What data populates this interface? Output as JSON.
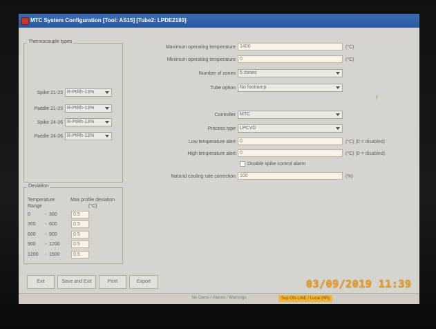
{
  "window": {
    "title": "MTC System Configuration [Tool: AS15] [Tube2: LPDE2180]"
  },
  "thermocouple": {
    "legend": "Thermocouple types",
    "rows": [
      {
        "label": "Spike 21-23",
        "value": "R-PtRh-13%"
      },
      {
        "label": "Paddle 21-23",
        "value": "R-PtRh-13%"
      },
      {
        "label": "Spike 24-26",
        "value": "R-PtRh-13%"
      },
      {
        "label": "Paddle 24-26",
        "value": "R-PtRh-13%"
      }
    ]
  },
  "deviation": {
    "legend": "Deviation",
    "col1": "Temperature\nRange",
    "col2": "Max profile deviation\n(°C)",
    "rows": [
      {
        "from": "0",
        "to": "300",
        "value": "0.5"
      },
      {
        "from": "300",
        "to": "600",
        "value": "0.5"
      },
      {
        "from": "600",
        "to": "900",
        "value": "0.5"
      },
      {
        "from": "900",
        "to": "1200",
        "value": "0.5"
      },
      {
        "from": "1200",
        "to": "1500",
        "value": "0.5"
      }
    ]
  },
  "settings": {
    "max_temp": {
      "label": "Maximum operating temperature",
      "value": "1400",
      "unit": "(°C)"
    },
    "min_temp": {
      "label": "Minimum operating temperature",
      "value": "0",
      "unit": "(°C)"
    },
    "zones": {
      "label": "Number of zones",
      "value": "5 zones"
    },
    "tube_option": {
      "label": "Tube option",
      "value": "No footramp"
    },
    "controller": {
      "label": "Controller",
      "value": "MTC"
    },
    "process_type": {
      "label": "Process type",
      "value": "LPCVD"
    },
    "low_alert": {
      "label": "Low temperature alert",
      "value": "0",
      "unit": "(°C)  (0 = disabled)"
    },
    "high_alert": {
      "label": "High temperature alert",
      "value": "0",
      "unit": "(°C)  (0 = disabled)"
    },
    "disable_spike": {
      "label": "Disable spike control alarm"
    },
    "cooling": {
      "label": "Natural cooling rate correction",
      "value": "100",
      "unit": "(%)"
    }
  },
  "buttons": {
    "exit": "Exit",
    "save_exit": "Save and Exit",
    "print": "Print",
    "export": "Export"
  },
  "status": {
    "center": "No Gems / Alarms / Warnings",
    "right": "Sup ON-LINE / Local (RR)"
  },
  "timestamp": "03/09/2019  11:39"
}
